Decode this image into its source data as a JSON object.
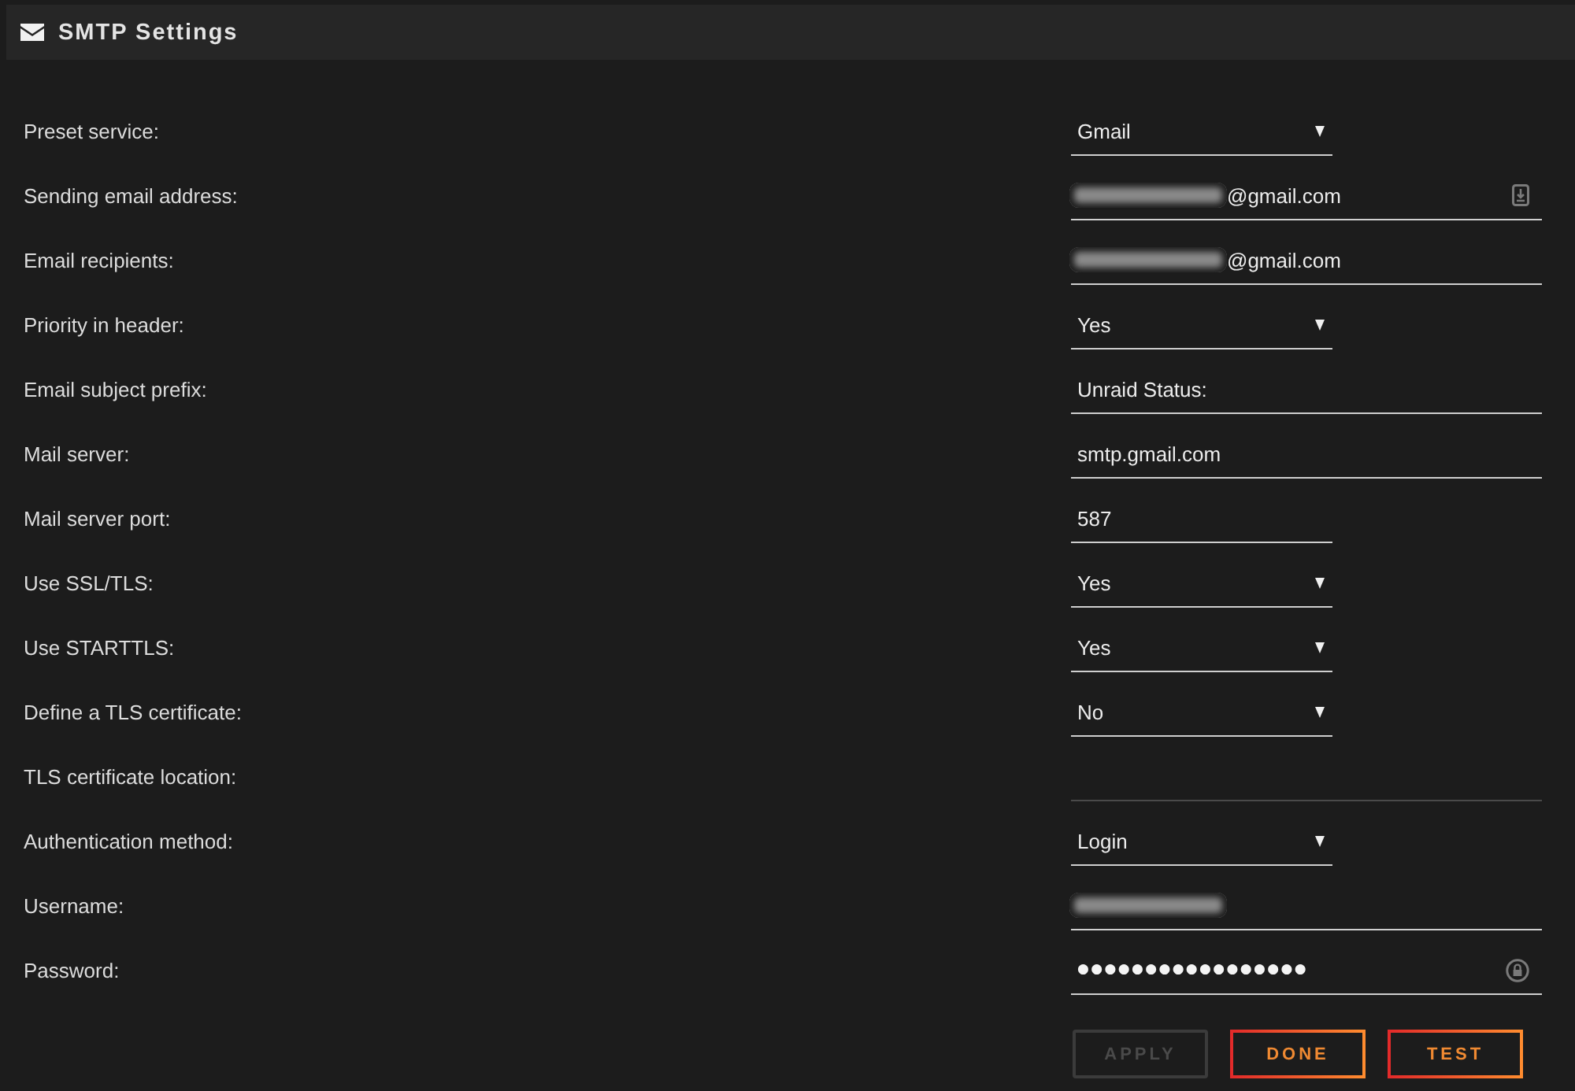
{
  "header": {
    "title": "SMTP Settings"
  },
  "fields": [
    {
      "label": "Preset service:",
      "kind": "select",
      "value": "Gmail",
      "redacted": false,
      "disabled": false
    },
    {
      "label": "Sending email address:",
      "kind": "address",
      "value": "@gmail.com",
      "redacted": true,
      "disabled": false
    },
    {
      "label": "Email recipients:",
      "kind": "text",
      "value": "@gmail.com",
      "redacted": true,
      "disabled": false
    },
    {
      "label": "Priority in header:",
      "kind": "select",
      "value": "Yes",
      "redacted": false,
      "disabled": false
    },
    {
      "label": "Email subject prefix:",
      "kind": "text",
      "value": "Unraid Status:",
      "redacted": false,
      "disabled": false
    },
    {
      "label": "Mail server:",
      "kind": "text",
      "value": "smtp.gmail.com",
      "redacted": false,
      "disabled": false
    },
    {
      "label": "Mail server port:",
      "kind": "number",
      "value": "587",
      "redacted": false,
      "disabled": false
    },
    {
      "label": "Use SSL/TLS:",
      "kind": "select",
      "value": "Yes",
      "redacted": false,
      "disabled": false
    },
    {
      "label": "Use STARTTLS:",
      "kind": "select",
      "value": "Yes",
      "redacted": false,
      "disabled": false
    },
    {
      "label": "Define a TLS certificate:",
      "kind": "select",
      "value": "No",
      "redacted": false,
      "disabled": false
    },
    {
      "label": "TLS certificate location:",
      "kind": "text",
      "redacted": false,
      "disabled": true
    },
    {
      "label": "Authentication method:",
      "kind": "select",
      "value": "Login",
      "redacted": false,
      "disabled": false
    },
    {
      "label": "Username:",
      "kind": "text",
      "redacted": true,
      "disabled": false
    },
    {
      "label": "Password:",
      "kind": "password",
      "value": "●●●●●●●●●●●●●●●●●",
      "redacted": false,
      "disabled": false
    }
  ],
  "buttons": [
    {
      "label": "APPLY",
      "disabled": true
    },
    {
      "label": "DONE",
      "disabled": false
    },
    {
      "label": "TEST",
      "disabled": false
    }
  ]
}
